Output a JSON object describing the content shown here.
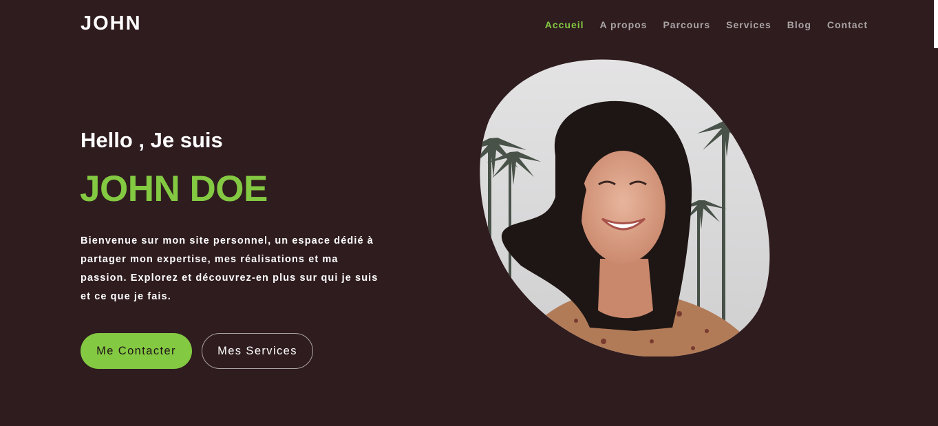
{
  "site": {
    "logo": "JOHN"
  },
  "nav": {
    "items": [
      {
        "label": "Accueil",
        "active": true
      },
      {
        "label": "A propos",
        "active": false
      },
      {
        "label": "Parcours",
        "active": false
      },
      {
        "label": "Services",
        "active": false
      },
      {
        "label": "Blog",
        "active": false
      },
      {
        "label": "Contact",
        "active": false
      }
    ]
  },
  "hero": {
    "greeting": "Hello , Je suis",
    "name": "JOHN DOE",
    "intro": "Bienvenue sur mon site personnel, un espace dédié à partager mon expertise, mes réalisations et ma passion. Explorez et découvrez-en plus sur qui je suis et ce que je fais.",
    "primary_button": "Me Contacter",
    "secondary_button": "Mes Services"
  },
  "colors": {
    "background": "#2f1c1f",
    "accent": "#83c942",
    "nav_text": "#a9a4a5",
    "text": "#ffffff"
  },
  "portrait": {
    "icon": "woman-portrait-photo"
  }
}
